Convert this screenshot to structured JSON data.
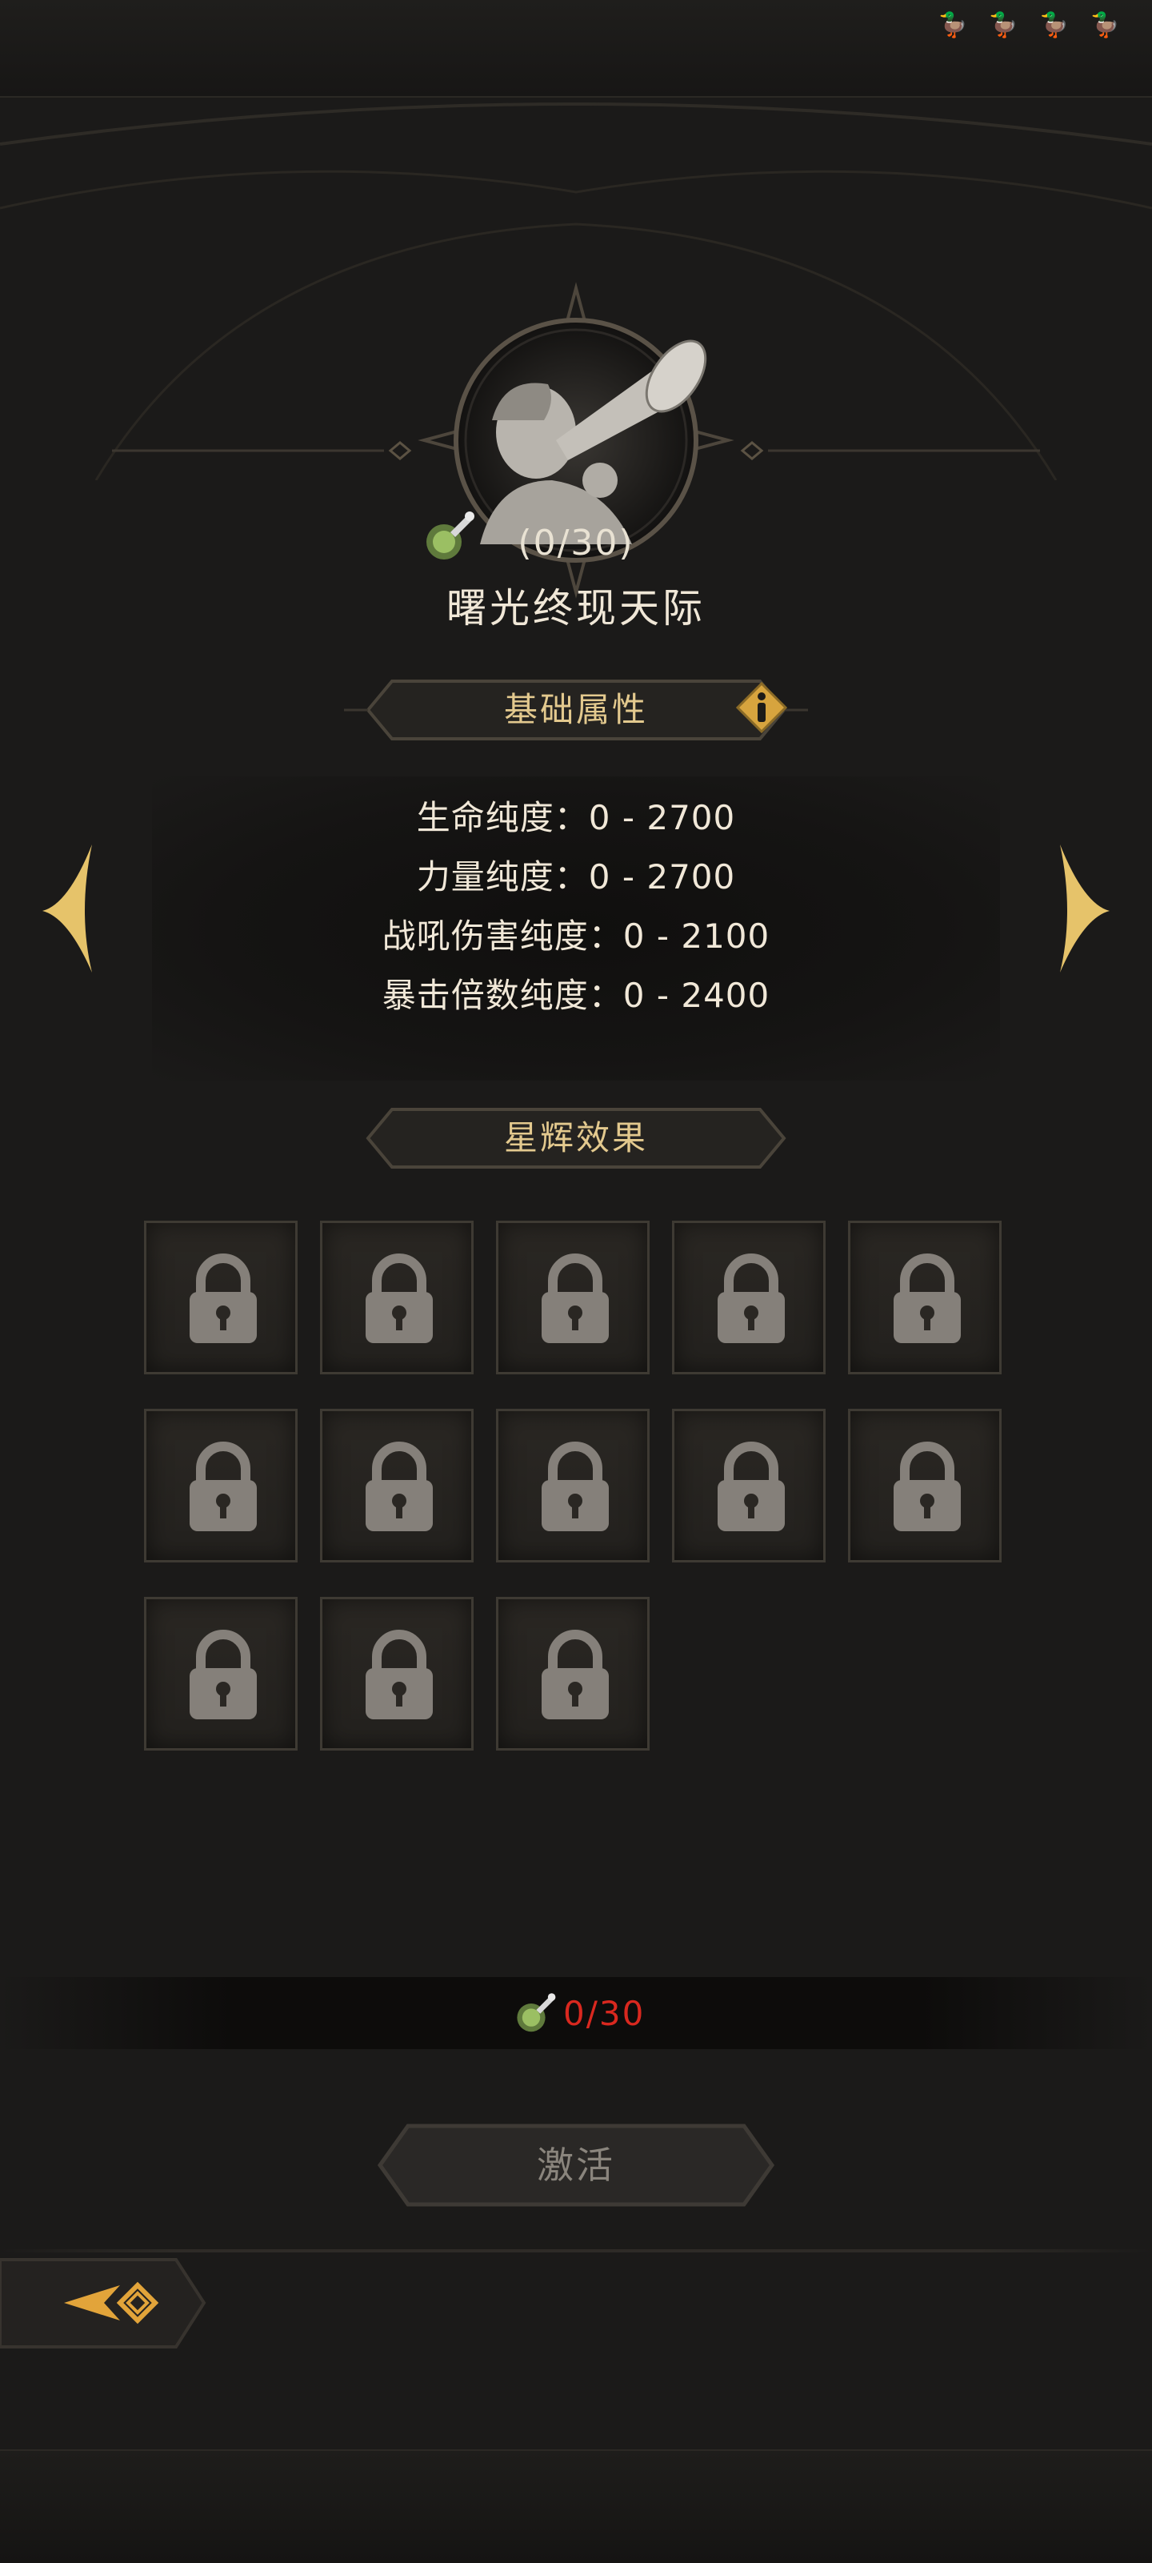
{
  "status_icons": [
    "duck-icon",
    "duck-icon",
    "duck-icon",
    "duck-icon"
  ],
  "constellation": {
    "progress": "(0/30)",
    "name": "曙光终现天际"
  },
  "basic_attributes": {
    "title": "基础属性",
    "stats": [
      "生命纯度：0  -  2700",
      "力量纯度：0  -  2700",
      "战吼伤害纯度：0  -  2100",
      "暴击倍数纯度：0  -  2400"
    ]
  },
  "star_effects": {
    "title": "星辉效果",
    "locked_slots": 13
  },
  "cost": {
    "text": "0/30"
  },
  "activate_button": {
    "label": "激活"
  },
  "colors": {
    "gold": "#e3c98e",
    "cost_red": "#d9281f",
    "bg": "#1b1a19"
  }
}
